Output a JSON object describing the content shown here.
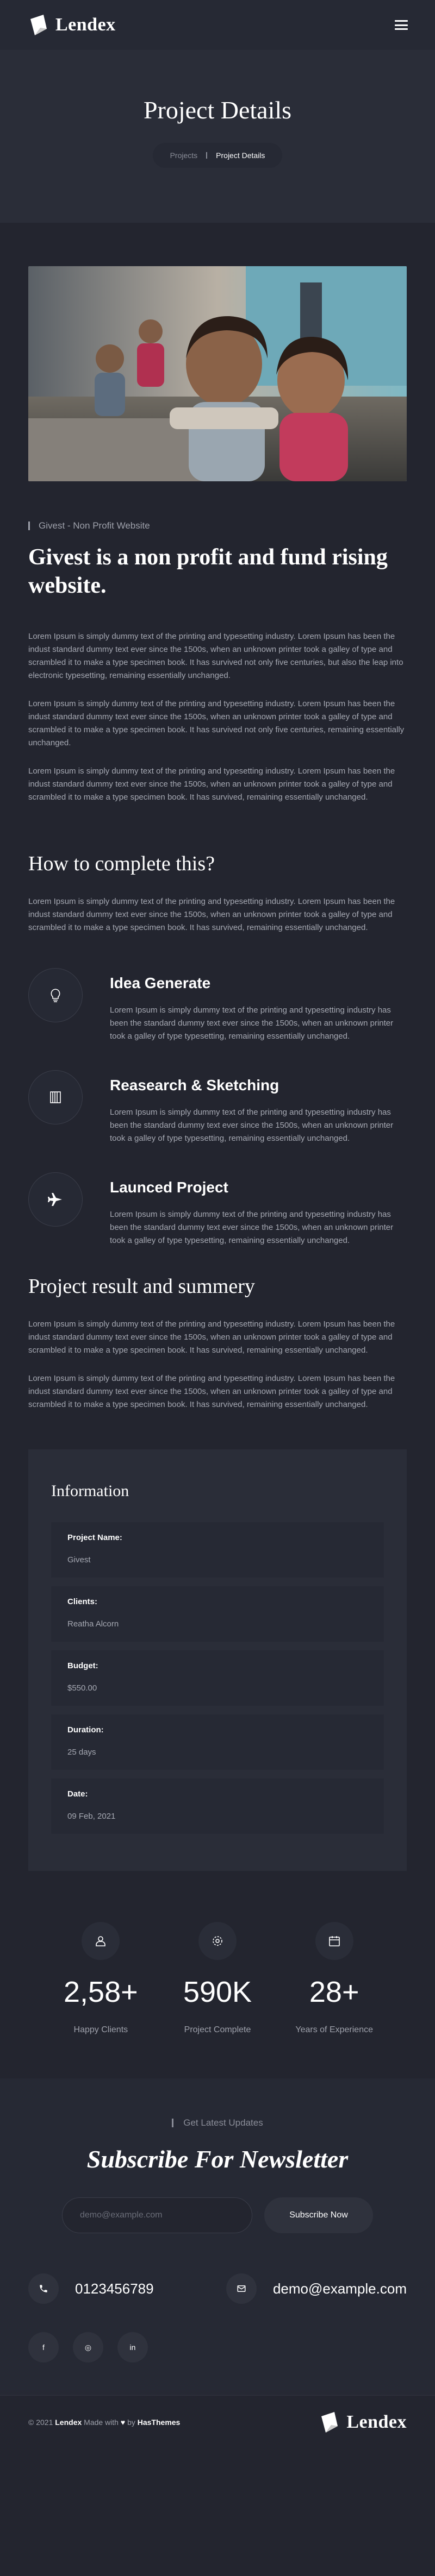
{
  "header": {
    "logo_text": "Lendex"
  },
  "page_title": {
    "title": "Project Details",
    "breadcrumb": [
      "Projects",
      "Project Details"
    ]
  },
  "tagline": "Givest - Non Profit Website",
  "main_title": "Givest is a non profit and fund rising website.",
  "intro_paragraphs": [
    "Lorem Ipsum is simply dummy text of the printing and typesetting industry. Lorem Ipsum has been the indust standard dummy text ever since the 1500s, when an unknown printer took a galley of type and scrambled it to make a type specimen book. It has survived not only five centuries, but also the leap into electronic typesetting, remaining essentially unchanged.",
    "Lorem Ipsum is simply dummy text of the printing and typesetting industry. Lorem Ipsum has been the indust standard dummy text ever since the 1500s, when an unknown printer took a galley of type and scrambled it to make a type specimen book. It has survived not only five centuries, remaining essentially unchanged.",
    "Lorem Ipsum is simply dummy text of the printing and typesetting industry. Lorem Ipsum has been the indust standard dummy text ever since the 1500s, when an unknown printer took a galley of type and scrambled it to make a type specimen book. It has survived, remaining essentially unchanged."
  ],
  "how": {
    "title": "How to complete this?",
    "paragraph": "Lorem Ipsum is simply dummy text of the printing and typesetting industry. Lorem Ipsum has been the indust standard dummy text ever since the 1500s, when an unknown printer took a galley of type and scrambled it to make a type specimen book. It has survived, remaining essentially unchanged."
  },
  "steps": [
    {
      "icon": "lightbulb-icon",
      "title": "Idea Generate",
      "text": "Lorem Ipsum is simply dummy text of the printing and typesetting industry has been the standard dummy text ever since the 1500s, when an unknown printer took a galley of type typesetting, remaining essentially unchanged."
    },
    {
      "icon": "sketch-icon",
      "title": "Reasearch & Sketching",
      "text": "Lorem Ipsum is simply dummy text of the printing and typesetting industry has been the standard dummy text ever since the 1500s, when an unknown printer took a galley of type typesetting, remaining essentially unchanged."
    },
    {
      "icon": "plane-icon",
      "title": "Launced Project",
      "text": "Lorem Ipsum is simply dummy text of the printing and typesetting industry has been the standard dummy text ever since the 1500s, when an unknown printer took a galley of type typesetting, remaining essentially unchanged."
    }
  ],
  "summary": {
    "title": "Project result and summery",
    "paragraphs": [
      "Lorem Ipsum is simply dummy text of the printing and typesetting industry. Lorem Ipsum has been the indust standard dummy text ever since the 1500s, when an unknown printer took a galley of type and scrambled it to make a type specimen book. It has survived, remaining essentially unchanged.",
      "Lorem Ipsum is simply dummy text of the printing and typesetting industry. Lorem Ipsum has been the indust standard dummy text ever since the 1500s, when an unknown printer took a galley of type and scrambled it to make a type specimen book. It has survived, remaining essentially unchanged."
    ]
  },
  "info": {
    "title": "Information",
    "rows": [
      {
        "label": "Project Name:",
        "value": "Givest"
      },
      {
        "label": "Clients:",
        "value": "Reatha Alcorn"
      },
      {
        "label": "Budget:",
        "value": "$550.00"
      },
      {
        "label": "Duration:",
        "value": "25 days"
      },
      {
        "label": "Date:",
        "value": "09 Feb, 2021"
      }
    ]
  },
  "stats": [
    {
      "icon": "user-icon",
      "value": "2,58+",
      "label": "Happy Clients"
    },
    {
      "icon": "gear-icon",
      "value": "590K",
      "label": "Project Complete"
    },
    {
      "icon": "calendar-icon",
      "value": "28+",
      "label": "Years of Experience"
    }
  ],
  "newsletter": {
    "tag": "Get Latest Updates",
    "title": "Subscribe For Newsletter",
    "placeholder": "demo@example.com",
    "button": "Subscribe Now"
  },
  "contact": {
    "phone": "0123456789",
    "email": "demo@example.com"
  },
  "socials": [
    "f",
    "◎",
    "in"
  ],
  "footer": {
    "copyright": "© 2021",
    "brand": "Lendex",
    "made_with": "Made with",
    "by": "by",
    "author": "HasThemes",
    "logo_text": "Lendex"
  }
}
